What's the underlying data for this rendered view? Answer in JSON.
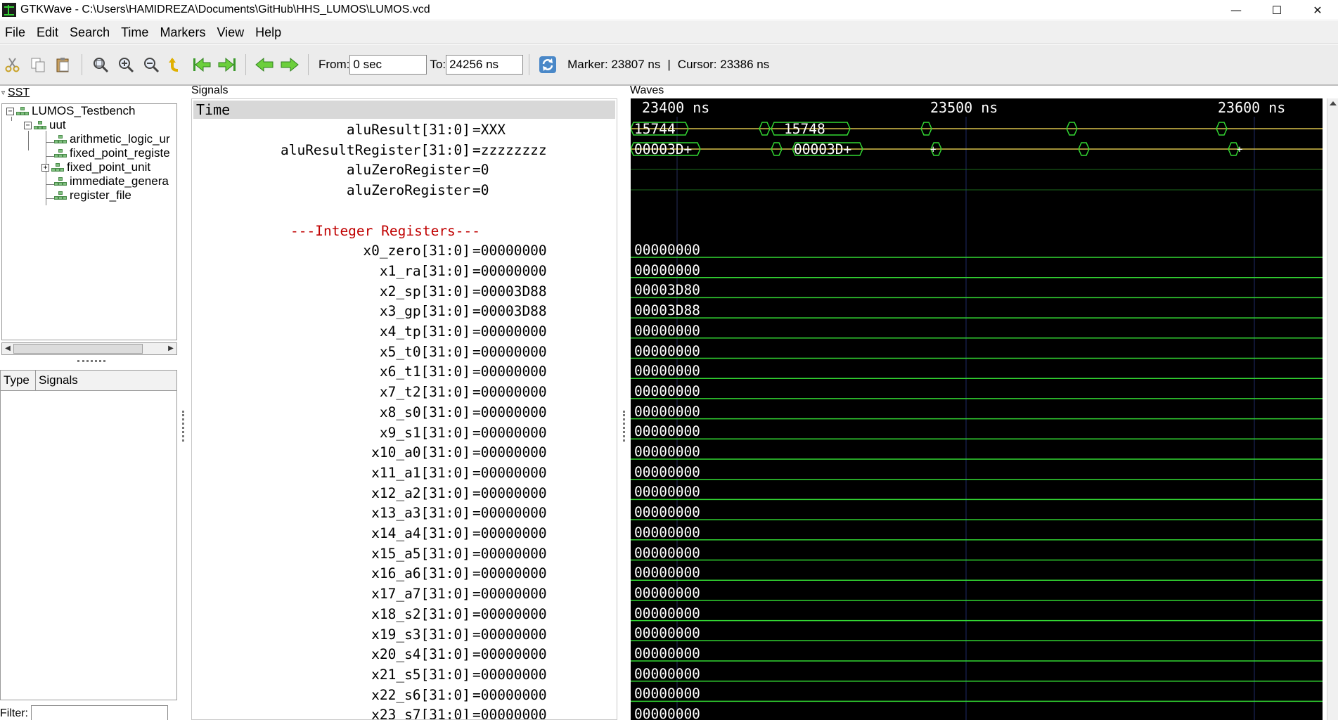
{
  "window": {
    "title": "GTKWave - C:\\Users\\HAMIDREZA\\Documents\\GitHub\\HHS_LUMOS\\LUMOS.vcd",
    "minimize": "—",
    "maximize": "☐",
    "close": "✕"
  },
  "menu": [
    "File",
    "Edit",
    "Search",
    "Time",
    "Markers",
    "View",
    "Help"
  ],
  "toolbar": {
    "icons": [
      "cut-icon",
      "copy-icon",
      "paste-icon",
      "zoom-fit-icon",
      "zoom-in-icon",
      "zoom-out-icon",
      "undo-zoom-icon",
      "zoom-start-icon",
      "zoom-end-icon",
      "previous-edge-icon",
      "next-edge-icon",
      "reload-icon"
    ],
    "from_label": "From:",
    "from_value": "0 sec",
    "to_label": "To:",
    "to_value": "24256 ns",
    "marker_text": "Marker: 23807 ns",
    "separator": "|",
    "cursor_text": "Cursor: 23386 ns"
  },
  "sst": {
    "header": "SST",
    "tree": [
      {
        "label": "LUMOS_Testbench",
        "expander": "−",
        "level": 0
      },
      {
        "label": "uut",
        "expander": "−",
        "level": 1
      },
      {
        "label": "arithmetic_logic_ur",
        "expander": "",
        "level": 2
      },
      {
        "label": "fixed_point_registe",
        "expander": "",
        "level": 2
      },
      {
        "label": "fixed_point_unit",
        "expander": "+",
        "level": 2
      },
      {
        "label": "immediate_genera",
        "expander": "",
        "level": 2
      },
      {
        "label": "register_file",
        "expander": "",
        "level": 2
      }
    ],
    "type_col": "Type",
    "signals_col": "Signals",
    "filter_label": "Filter:",
    "filter_value": ""
  },
  "signals": {
    "header": "Signals",
    "time_label": "Time",
    "rows": [
      {
        "name": "aluResult[31:0]",
        "value": "=XXX"
      },
      {
        "name": "aluResultRegister[31:0]",
        "value": "=zzzzzzzz"
      },
      {
        "name": "aluZeroRegister",
        "value": "=0"
      },
      {
        "name": "aluZeroRegister",
        "value": "=0"
      },
      {
        "name": "",
        "value": ""
      },
      {
        "comment": "---Integer Registers---"
      },
      {
        "name": "x0_zero[31:0]",
        "value": "=00000000"
      },
      {
        "name": "x1_ra[31:0]",
        "value": "=00000000"
      },
      {
        "name": "x2_sp[31:0]",
        "value": "=00003D88"
      },
      {
        "name": "x3_gp[31:0]",
        "value": "=00003D88"
      },
      {
        "name": "x4_tp[31:0]",
        "value": "=00000000"
      },
      {
        "name": "x5_t0[31:0]",
        "value": "=00000000"
      },
      {
        "name": "x6_t1[31:0]",
        "value": "=00000000"
      },
      {
        "name": "x7_t2[31:0]",
        "value": "=00000000"
      },
      {
        "name": "x8_s0[31:0]",
        "value": "=00000000"
      },
      {
        "name": "x9_s1[31:0]",
        "value": "=00000000"
      },
      {
        "name": "x10_a0[31:0]",
        "value": "=00000000"
      },
      {
        "name": "x11_a1[31:0]",
        "value": "=00000000"
      },
      {
        "name": "x12_a2[31:0]",
        "value": "=00000000"
      },
      {
        "name": "x13_a3[31:0]",
        "value": "=00000000"
      },
      {
        "name": "x14_a4[31:0]",
        "value": "=00000000"
      },
      {
        "name": "x15_a5[31:0]",
        "value": "=00000000"
      },
      {
        "name": "x16_a6[31:0]",
        "value": "=00000000"
      },
      {
        "name": "x17_a7[31:0]",
        "value": "=00000000"
      },
      {
        "name": "x18_s2[31:0]",
        "value": "=00000000"
      },
      {
        "name": "x19_s3[31:0]",
        "value": "=00000000"
      },
      {
        "name": "x20_s4[31:0]",
        "value": "=00000000"
      },
      {
        "name": "x21_s5[31:0]",
        "value": "=00000000"
      },
      {
        "name": "x22_s6[31:0]",
        "value": "=00000000"
      },
      {
        "name": "x23_s7[31:0]",
        "value": "=00000000"
      }
    ]
  },
  "waves": {
    "header": "Waves",
    "time_ticks": [
      "23400 ns",
      "23500 ns",
      "23600 ns"
    ],
    "alu_result_labels": [
      "15744",
      "15748"
    ],
    "alu_result_register_labels": [
      "00003D+",
      "00003D+",
      "+",
      "+"
    ],
    "register_wave_values": [
      "00000000",
      "00000000",
      "00003D80",
      "00003D88",
      "00000000",
      "00000000",
      "00000000",
      "00000000",
      "00000000",
      "00000000",
      "00000000",
      "00000000",
      "00000000",
      "00000000",
      "00000000",
      "00000000",
      "00000000",
      "00000000",
      "00000000",
      "00000000",
      "00000000",
      "00000000",
      "00000000",
      "00000000"
    ],
    "colors": {
      "trace": "#33d833",
      "bus": "#d7c14a",
      "grid": "#1e2a66",
      "background": "#000000",
      "text": "#ffffff"
    }
  }
}
